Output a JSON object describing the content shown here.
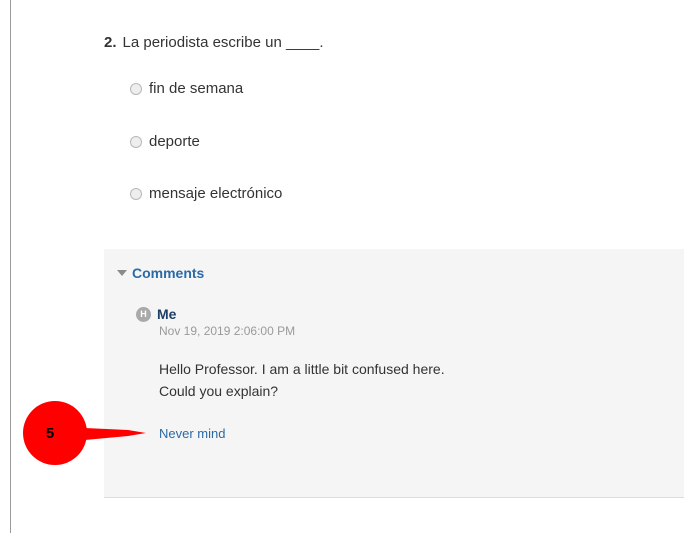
{
  "question": {
    "number": "2.",
    "text": "La periodista escribe un ____."
  },
  "options": [
    {
      "label": "fin de semana"
    },
    {
      "label": "deporte"
    },
    {
      "label": "mensaje electrónico"
    }
  ],
  "comments": {
    "header": "Comments",
    "items": [
      {
        "avatar_initial": "H",
        "author": "Me",
        "timestamp": "Nov 19, 2019 2:06:00 PM",
        "body": "Hello Professor. I am a little bit confused here. Could you explain?",
        "action_link": "Never mind"
      }
    ]
  },
  "annotation": {
    "number": "5",
    "color": "#ff0000"
  }
}
